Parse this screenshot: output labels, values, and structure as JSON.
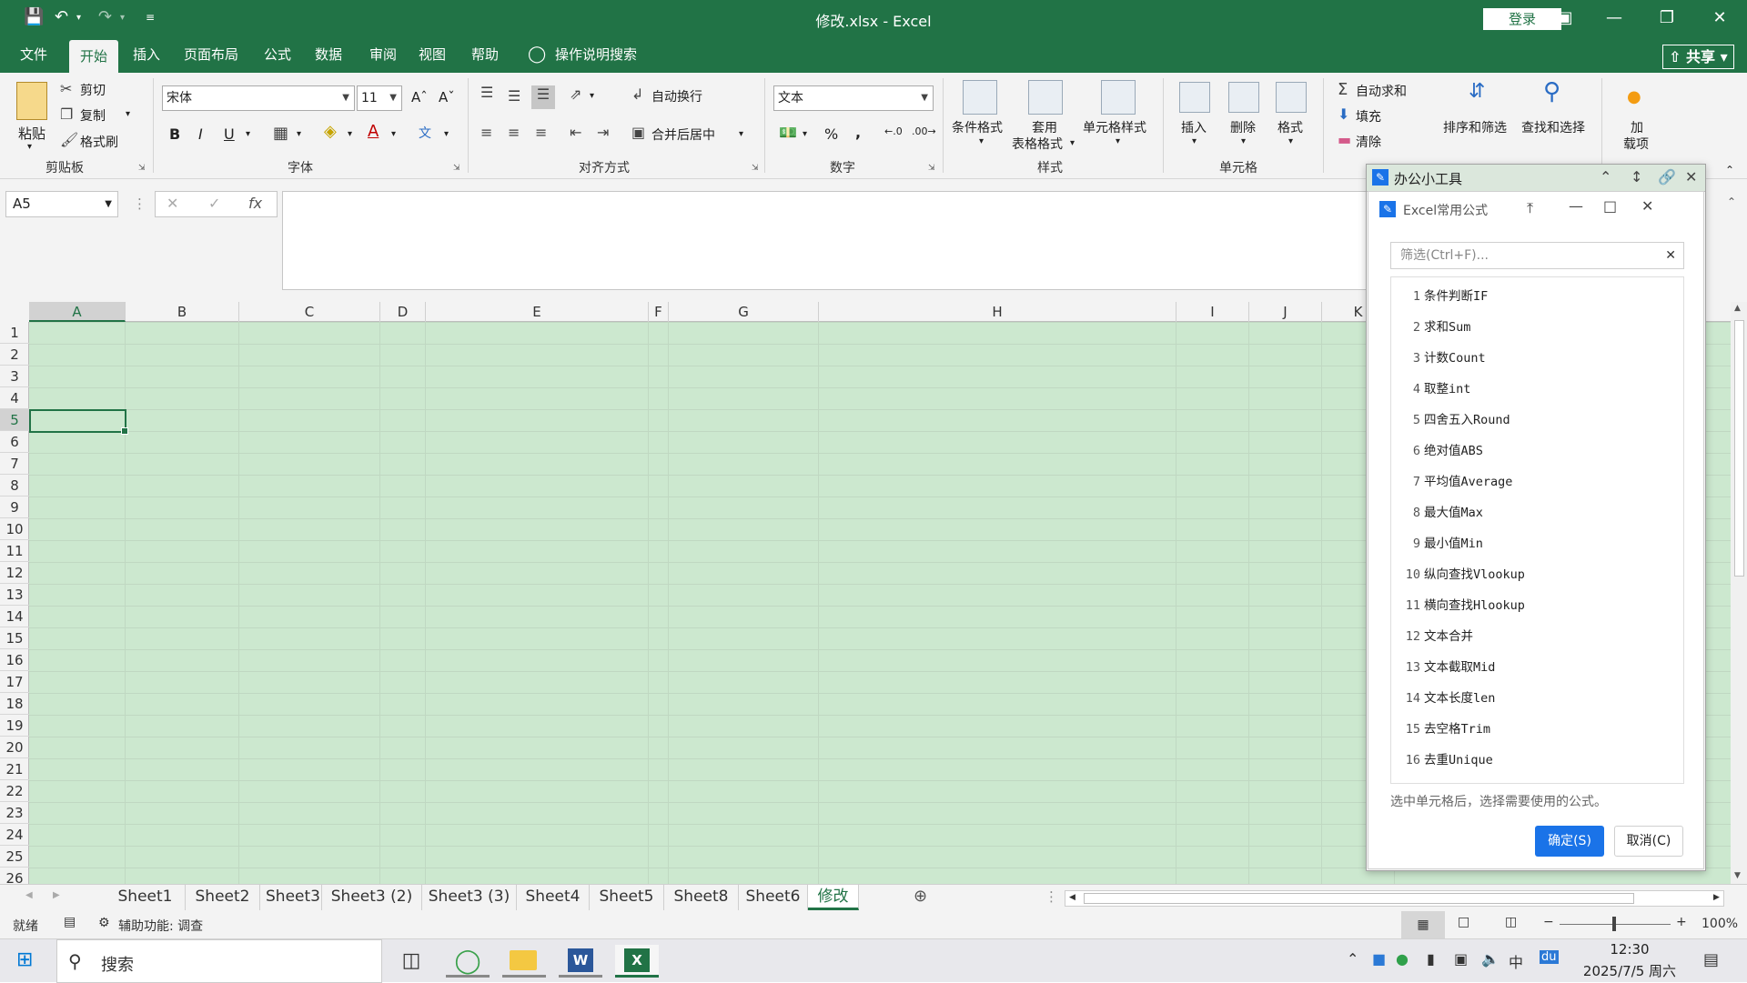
{
  "window": {
    "title": "修改.xlsx  -  Excel",
    "login": "登录"
  },
  "menu": {
    "tabs": [
      "文件",
      "开始",
      "插入",
      "页面布局",
      "公式",
      "数据",
      "审阅",
      "视图",
      "帮助"
    ],
    "active": "开始",
    "search": "操作说明搜索",
    "share": "共享"
  },
  "ribbon": {
    "clipboard": {
      "paste": "粘贴",
      "cut": "剪切",
      "copy": "复制",
      "format_painter": "格式刷",
      "label": "剪贴板"
    },
    "font": {
      "name": "宋体",
      "size": "11",
      "bold": "B",
      "italic": "I",
      "underline": "U",
      "label": "字体"
    },
    "alignment": {
      "wrap": "自动换行",
      "merge": "合并后居中",
      "label": "对齐方式"
    },
    "number": {
      "format": "文本",
      "percent": "%",
      "comma": ",",
      "label": "数字"
    },
    "styles": {
      "conditional": "条件格式",
      "table_fmt_1": "套用",
      "table_fmt_2": "表格格式",
      "cell_style": "单元格样式",
      "label": "样式"
    },
    "cells": {
      "insert": "插入",
      "delete": "删除",
      "format": "格式",
      "label": "单元格"
    },
    "editing": {
      "autosum": "自动求和",
      "fill": "填充",
      "clear": "清除",
      "sort_filter": "排序和筛选",
      "find_select": "查找和选择"
    },
    "addins": {
      "line1": "加",
      "line2": "载项"
    }
  },
  "formula_bar": {
    "name_box": "A5",
    "fx": "fx",
    "content": ""
  },
  "grid": {
    "columns": [
      "A",
      "B",
      "C",
      "D",
      "E",
      "F",
      "G",
      "H",
      "I",
      "J",
      "K"
    ],
    "rows": [
      "1",
      "2",
      "3",
      "4",
      "5",
      "6",
      "7",
      "8",
      "9",
      "10",
      "11",
      "12",
      "13",
      "14",
      "15",
      "16",
      "17",
      "18",
      "19",
      "20",
      "21",
      "22",
      "23",
      "24",
      "25",
      "26"
    ],
    "active_col": "A",
    "active_row": "5"
  },
  "sheets": {
    "tabs": [
      "Sheet1",
      "Sheet2",
      "Sheet3",
      "Sheet3 (2)",
      "Sheet3 (3)",
      "Sheet4",
      "Sheet5",
      "Sheet8",
      "Sheet6",
      "修改"
    ],
    "active": "修改"
  },
  "status": {
    "ready": "就绪",
    "accessibility": "辅助功能: 调查",
    "zoom": "100%"
  },
  "taskbar": {
    "search": "搜索",
    "time": "12:30",
    "date": "2025/7/5 周六"
  },
  "tool_panel": {
    "title": "办公小工具",
    "dialog_title": "Excel常用公式",
    "filter_placeholder": "筛选(Ctrl+F)...",
    "items": [
      {
        "num": "1",
        "label": "条件判断IF"
      },
      {
        "num": "2",
        "label": "求和Sum"
      },
      {
        "num": "3",
        "label": "计数Count"
      },
      {
        "num": "4",
        "label": "取整int"
      },
      {
        "num": "5",
        "label": "四舍五入Round"
      },
      {
        "num": "6",
        "label": "绝对值ABS"
      },
      {
        "num": "7",
        "label": "平均值Average"
      },
      {
        "num": "8",
        "label": "最大值Max"
      },
      {
        "num": "9",
        "label": "最小值Min"
      },
      {
        "num": "10",
        "label": "纵向查找Vlookup"
      },
      {
        "num": "11",
        "label": "横向查找Hlookup"
      },
      {
        "num": "12",
        "label": "文本合并"
      },
      {
        "num": "13",
        "label": "文本截取Mid"
      },
      {
        "num": "14",
        "label": "文本长度len"
      },
      {
        "num": "15",
        "label": "去空格Trim"
      },
      {
        "num": "16",
        "label": "去重Unique"
      }
    ],
    "hint": "选中单元格后，选择需要使用的公式。",
    "ok": "确定(S)",
    "cancel": "取消(C)"
  },
  "colors": {
    "excel_green": "#217346",
    "sheet_bg": "#cce8cf",
    "accent_blue": "#1a73e8"
  }
}
